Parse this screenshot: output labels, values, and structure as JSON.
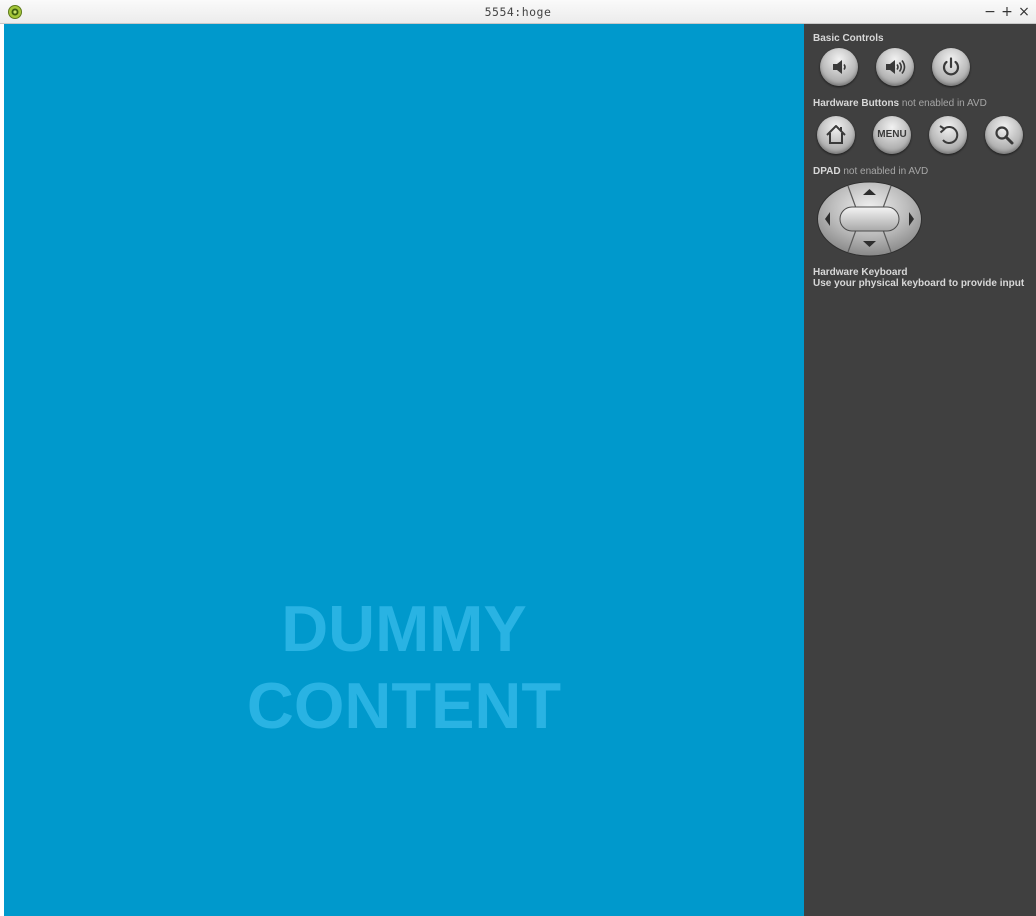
{
  "window": {
    "title": "5554:hoge",
    "minimize_label": "−",
    "maximize_label": "+",
    "close_label": "×"
  },
  "screen": {
    "line1": "DUMMY",
    "line2": "CONTENT",
    "background": "#0099cc",
    "text_color": "#29b3e3"
  },
  "panel": {
    "basic_controls_label": "Basic Controls",
    "hardware_buttons_label": "Hardware Buttons",
    "hardware_buttons_note": "not enabled in AVD",
    "dpad_label": "DPAD",
    "dpad_note": "not enabled in AVD",
    "keyboard_label": "Hardware Keyboard",
    "keyboard_note": "Use your physical keyboard to provide input",
    "menu_button_label": "MENU",
    "basic_buttons": [
      "volume-down-icon",
      "volume-up-icon",
      "power-icon"
    ],
    "hardware_buttons": [
      "home-icon",
      "menu",
      "back-icon",
      "search-icon"
    ],
    "background": "#404040"
  }
}
